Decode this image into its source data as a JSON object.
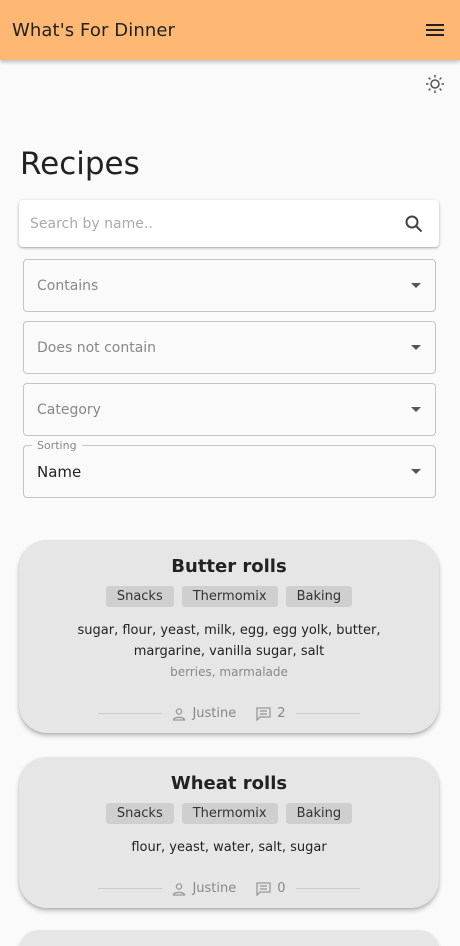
{
  "app_bar": {
    "title": "What's For Dinner",
    "menu_icon": "menu-icon"
  },
  "theme_toggle": {
    "icon": "sun-icon"
  },
  "page": {
    "title": "Recipes"
  },
  "search": {
    "placeholder": "Search by name..",
    "value": "",
    "icon": "search-icon"
  },
  "filters": {
    "contains": {
      "placeholder": "Contains"
    },
    "does_not_contain": {
      "placeholder": "Does not contain"
    },
    "category": {
      "placeholder": "Category"
    },
    "sorting": {
      "label": "Sorting",
      "value": "Name"
    }
  },
  "recipes": [
    {
      "title": "Butter rolls",
      "tags": [
        "Snacks",
        "Thermomix",
        "Baking"
      ],
      "ingredients": "sugar, flour, yeast, milk, egg, egg yolk, butter, margarine, vanilla sugar, salt",
      "optional": "berries, marmalade",
      "author": "Justine",
      "comments": "2"
    },
    {
      "title": "Wheat rolls",
      "tags": [
        "Snacks",
        "Thermomix",
        "Baking"
      ],
      "ingredients": "flour, yeast, water, salt, sugar",
      "author": "Justine",
      "comments": "0"
    }
  ]
}
